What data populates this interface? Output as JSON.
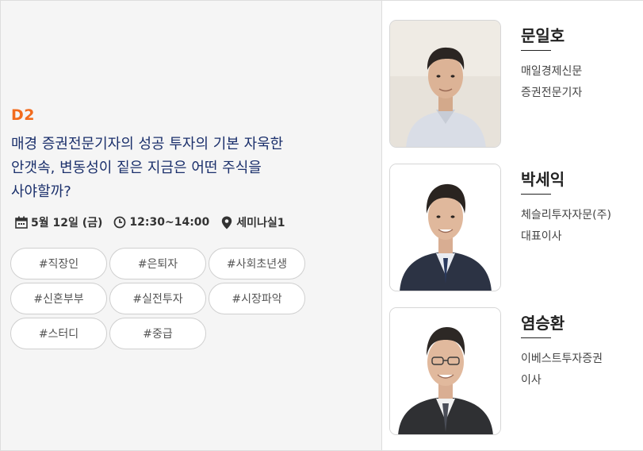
{
  "session": {
    "day": "D2",
    "title_line1": "매경 증권전문기자의 성공 투자의 기본 자욱한",
    "title_line2": "안갯속, 변동성이 짙은 지금은 어떤 주식을",
    "title_line3": "사야할까?",
    "date": "5월 12일 (금)",
    "time": "12:30~14:00",
    "location": "세미나실1",
    "accent_color": "#f26b1d",
    "title_color": "#1a2f6b"
  },
  "icons": {
    "date": "calendar-icon",
    "time": "clock-icon",
    "location": "map-pin-icon"
  },
  "tags": [
    "#직장인",
    "#은퇴자",
    "#사회초년생",
    "#신혼부부",
    "#실전투자",
    "#시장파악",
    "#스터디",
    "#중급"
  ],
  "speakers": [
    {
      "name": "문일호",
      "org": "매일경제신문",
      "role": "증권전문기자"
    },
    {
      "name": "박세익",
      "org": "체슬리투자자문(주)",
      "role": "대표이사"
    },
    {
      "name": "염승환",
      "org": "이베스트투자증권",
      "role": "이사"
    }
  ]
}
